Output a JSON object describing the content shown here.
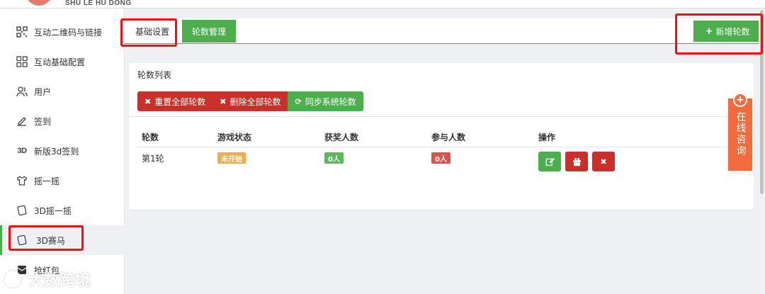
{
  "header": {
    "brand_subtitle": "SHU LE HU DONG"
  },
  "sidebar": {
    "items": [
      {
        "label": "互动二维码与链接",
        "icon": "qr-code-icon"
      },
      {
        "label": "互动基础配置",
        "icon": "grid-icon"
      },
      {
        "label": "用户",
        "icon": "users-icon"
      },
      {
        "label": "签到",
        "icon": "edit-icon"
      },
      {
        "label": "新版3d签到",
        "icon": "3d-icon",
        "icon_text": "3D"
      },
      {
        "label": "摇一摇",
        "icon": "shirt-icon"
      },
      {
        "label": "3D摇一摇",
        "icon": "tablet-icon"
      },
      {
        "label": "3D赛马",
        "icon": "tablet-icon",
        "active": true
      },
      {
        "label": "抢红包",
        "icon": "red-envelope-icon"
      }
    ]
  },
  "tabs": {
    "basic": "基础设置",
    "rounds": "轮数管理"
  },
  "toolbar": {
    "add_round": "新增轮数"
  },
  "panel": {
    "title": "轮数列表",
    "actions": {
      "reset_all": "重置全部轮数",
      "delete_all": "删除全部轮数",
      "sync": "同步系统轮数"
    }
  },
  "table": {
    "headers": [
      "轮数",
      "游戏状态",
      "获奖人数",
      "参与人数",
      "操作"
    ],
    "rows": [
      {
        "round": "第1轮",
        "status": "未开始",
        "winners": "0人",
        "participants": "0人"
      }
    ]
  },
  "consult": {
    "label": "在线咨询"
  },
  "watermark": {
    "text": "大数跨境"
  },
  "colors": {
    "green": "#4cae4c",
    "red": "#c9302c",
    "orange": "#f26a3d",
    "highlight": "#ee1111"
  }
}
